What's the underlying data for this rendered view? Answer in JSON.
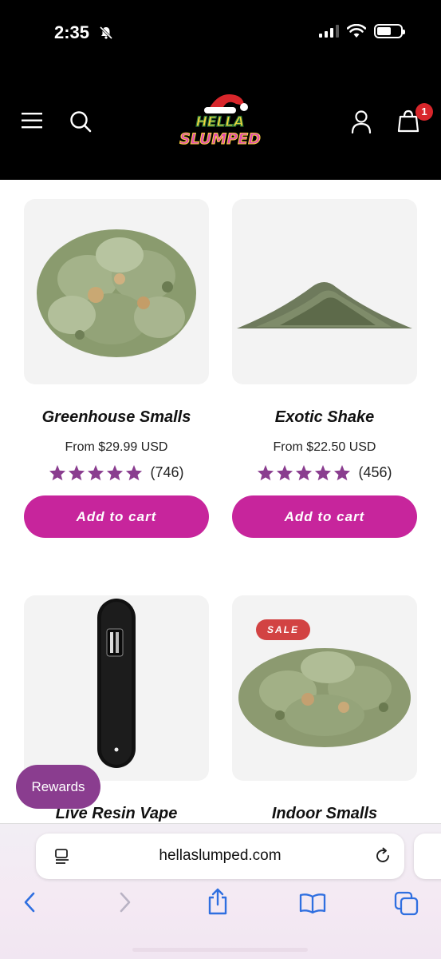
{
  "status_bar": {
    "time": "2:35"
  },
  "header": {
    "logo_text_top": "HELLA",
    "logo_text_bottom": "SLUMPED",
    "cart_count": "1"
  },
  "products": [
    {
      "title": "Greenhouse Smalls",
      "price": "From $29.99 USD",
      "rating_count": "(746)",
      "button_label": "Add to cart"
    },
    {
      "title": "Exotic Shake",
      "price": "From $22.50 USD",
      "rating_count": "(456)",
      "button_label": "Add to cart"
    },
    {
      "title": "Live Resin Vape"
    },
    {
      "title": "Indoor Smalls",
      "badge": "SALE"
    }
  ],
  "rewards_label": "Rewards",
  "browser": {
    "url": "hellaslumped.com"
  },
  "colors": {
    "accent": "#c7259c",
    "star": "#8a3d8f",
    "sale": "#d24343",
    "rewards": "#8a3d8f"
  }
}
